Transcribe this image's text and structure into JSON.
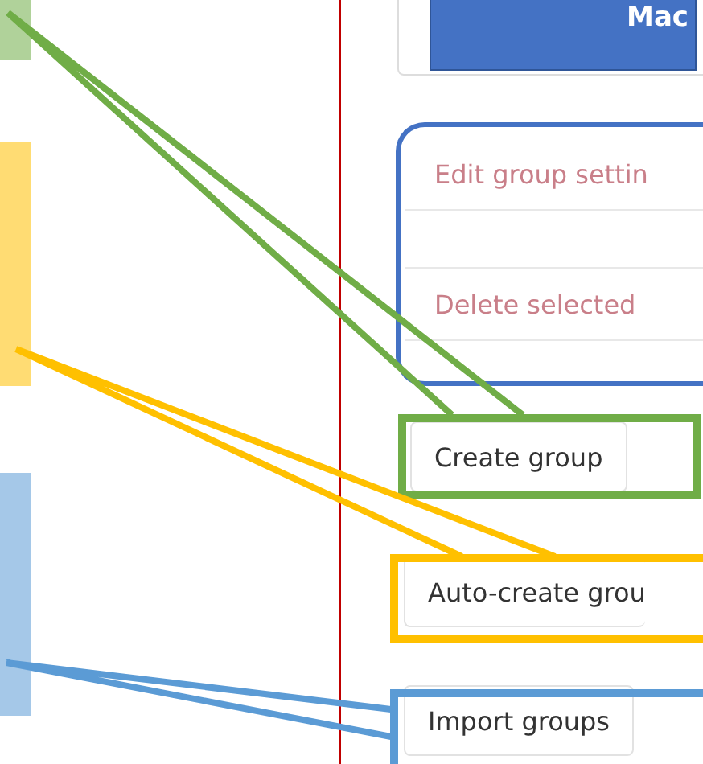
{
  "top_button": {
    "label": "Mac"
  },
  "group_actions": [
    {
      "kind": "item",
      "label": "Edit group settin"
    },
    {
      "kind": "blank"
    },
    {
      "kind": "item",
      "label": "Delete selected"
    }
  ],
  "buttons": [
    {
      "label": "Create group"
    },
    {
      "label": "Auto-create grou"
    },
    {
      "label": "Import groups"
    }
  ],
  "callouts": [
    {
      "color": "#70ad47"
    },
    {
      "color": "#ffc000"
    },
    {
      "color": "#5b9bd5"
    }
  ]
}
